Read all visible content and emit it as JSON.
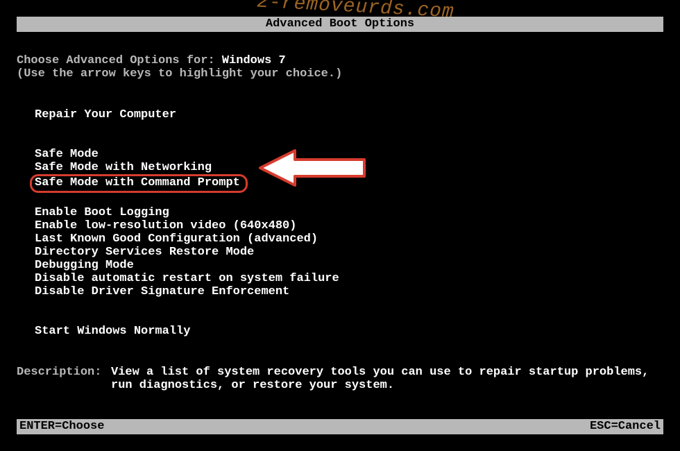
{
  "watermark": "2-removeurds.com",
  "title": "Advanced Boot Options",
  "header": {
    "choose_prefix": "Choose Advanced Options for: ",
    "os_name": "Windows 7",
    "hint": "(Use the arrow keys to highlight your choice.)"
  },
  "menu": {
    "repair": "Repair Your Computer",
    "safe_mode": "Safe Mode",
    "safe_mode_net": "Safe Mode with Networking",
    "safe_mode_cmd": "Safe Mode with Command Prompt",
    "boot_logging": "Enable Boot Logging",
    "low_res": "Enable low-resolution video (640x480)",
    "last_known": "Last Known Good Configuration (advanced)",
    "dir_services": "Directory Services Restore Mode",
    "debugging": "Debugging Mode",
    "disable_restart": "Disable automatic restart on system failure",
    "disable_driver_sig": "Disable Driver Signature Enforcement",
    "start_normal": "Start Windows Normally"
  },
  "description": {
    "label": "Description:",
    "text": "View a list of system recovery tools you can use to repair startup problems, run diagnostics, or restore your system."
  },
  "footer": {
    "enter": "ENTER=Choose",
    "esc": "ESC=Cancel"
  }
}
